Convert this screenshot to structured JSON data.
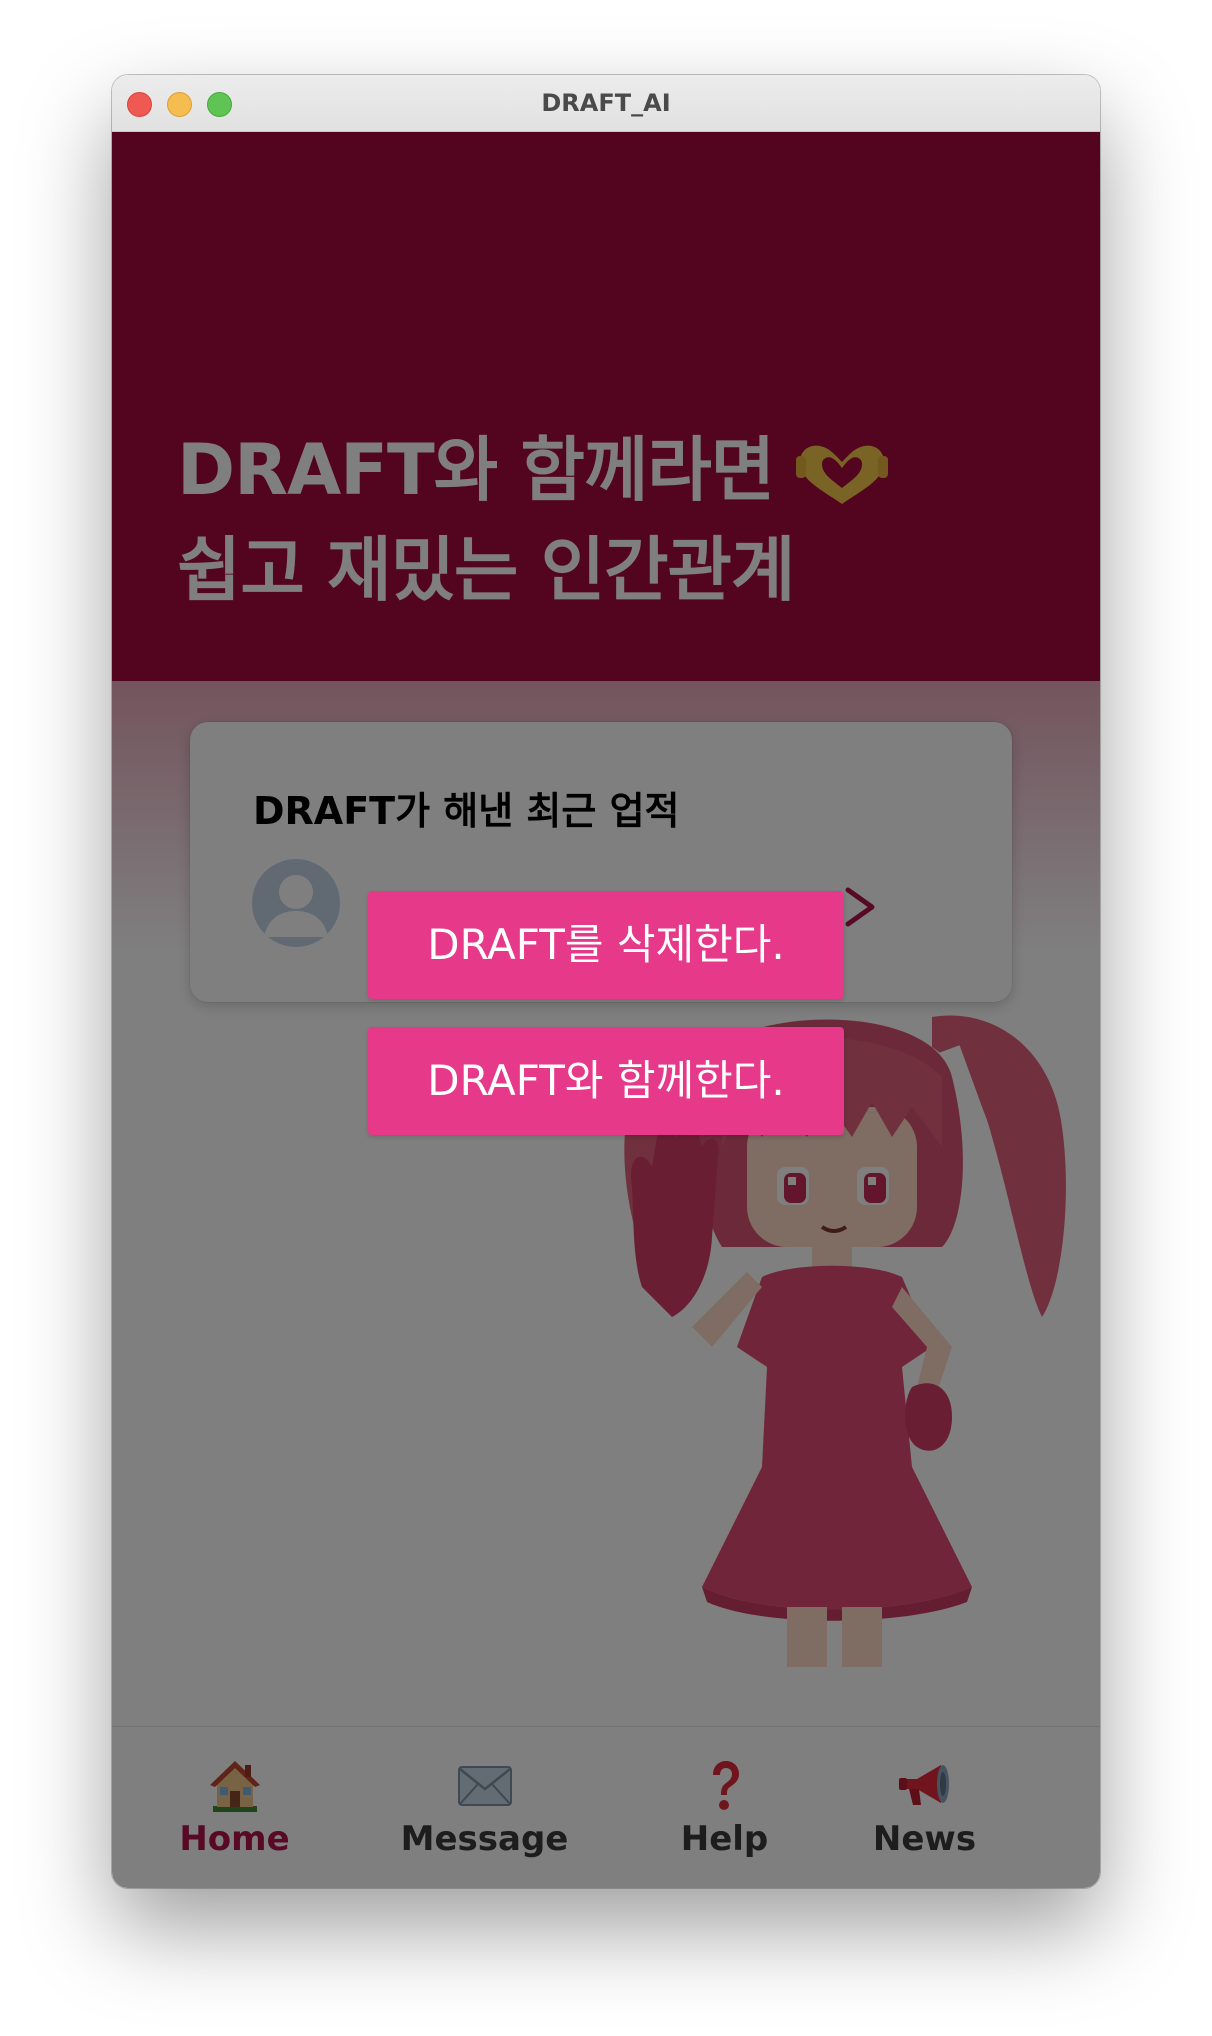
{
  "window": {
    "title": "DRAFT_AI"
  },
  "hero": {
    "line1": "DRAFT와 함께라면",
    "line2": "쉽고 재밌는 인간관계",
    "icon": "heart-hands-icon",
    "background_color": "#a60a3f"
  },
  "card": {
    "title": "DRAFT가 해낸 최근 업적",
    "item_text": "　",
    "avatar_icon": "user-avatar-icon",
    "chevron_icon": "chevron-right-icon"
  },
  "menu": {
    "delete_label": "DRAFT를 삭제한다.",
    "together_label": "DRAFT와 함께한다.",
    "button_color": "#e6398a"
  },
  "tabs": [
    {
      "label": "Home",
      "icon": "house-icon",
      "active": true
    },
    {
      "label": "Message",
      "icon": "envelope-icon",
      "active": false
    },
    {
      "label": "Help",
      "icon": "question-icon",
      "active": false
    },
    {
      "label": "News",
      "icon": "megaphone-icon",
      "active": false
    }
  ],
  "colors": {
    "accent": "#b0134c",
    "overlay": "rgba(0,0,0,0.5)"
  }
}
